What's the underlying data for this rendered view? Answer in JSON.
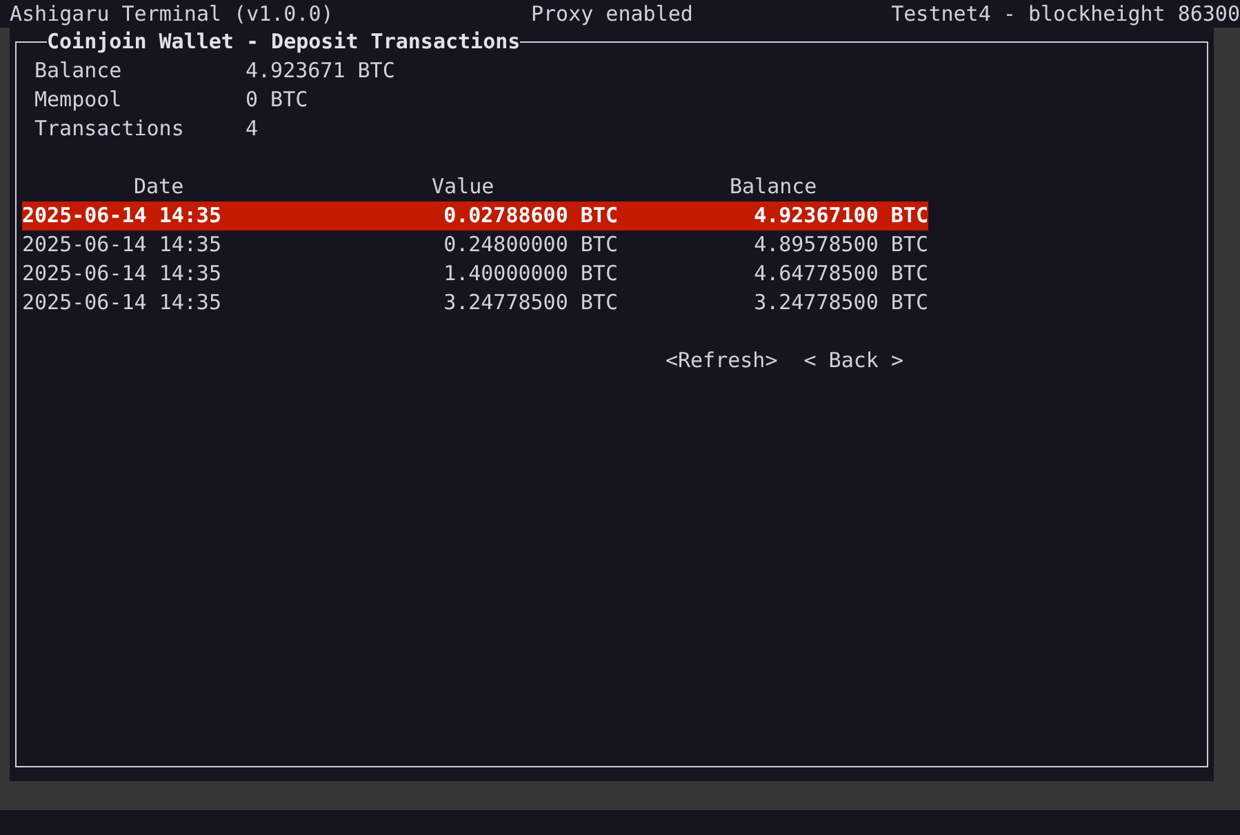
{
  "top_bar": {
    "title": "Ashigaru Terminal (v1.0.0)",
    "proxy_status": "Proxy enabled",
    "network_status": "Testnet4 - blockheight 86300"
  },
  "panel": {
    "title": "Coinjoin Wallet - Deposit Transactions"
  },
  "summary": [
    {
      "label": "Balance",
      "value": "4.923671 BTC"
    },
    {
      "label": "Mempool",
      "value": "0 BTC"
    },
    {
      "label": "Transactions",
      "value": "4"
    }
  ],
  "table": {
    "columns": [
      "Date",
      "Value",
      "Balance"
    ],
    "rows": [
      {
        "cells": [
          "2025-06-14 14:35",
          "0.02788600 BTC",
          "4.92367100 BTC"
        ],
        "selected": true
      },
      {
        "cells": [
          "2025-06-14 14:35",
          "0.24800000 BTC",
          "4.89578500 BTC"
        ],
        "selected": false
      },
      {
        "cells": [
          "2025-06-14 14:35",
          "1.40000000 BTC",
          "4.64778500 BTC"
        ],
        "selected": false
      },
      {
        "cells": [
          "2025-06-14 14:35",
          "3.24778500 BTC",
          "3.24778500 BTC"
        ],
        "selected": false
      }
    ]
  },
  "buttons": [
    {
      "label": "<Refresh>"
    },
    {
      "label": "< Back >"
    }
  ]
}
